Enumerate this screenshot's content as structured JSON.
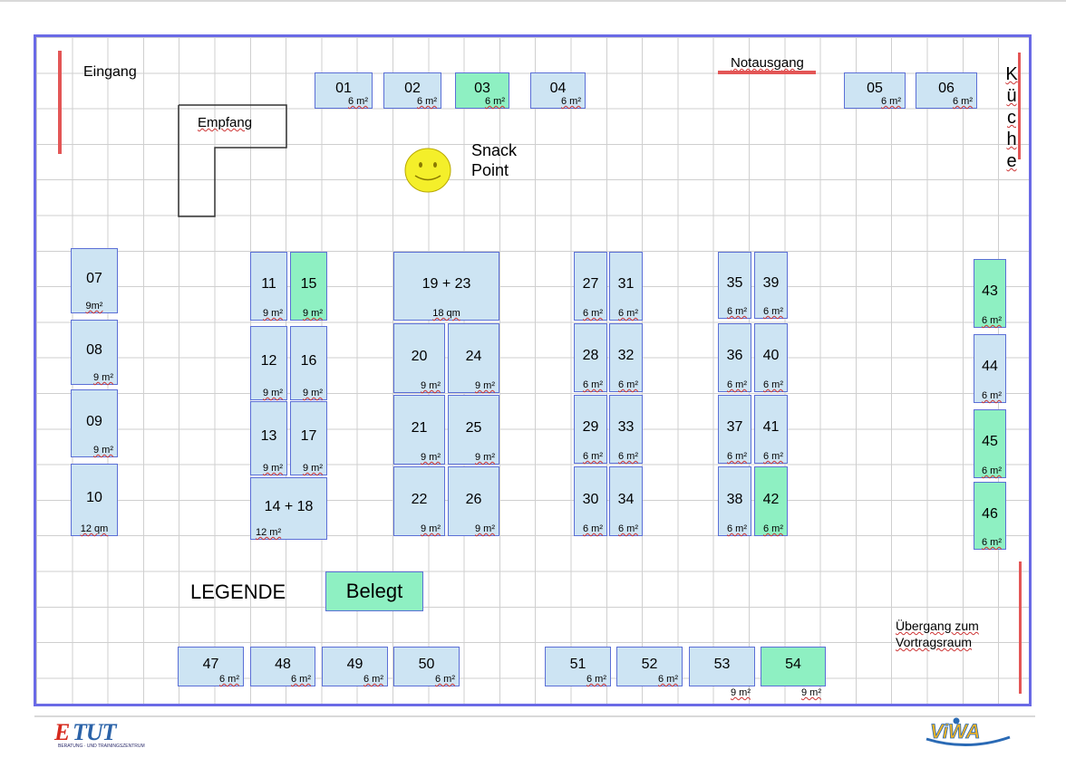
{
  "labels": {
    "entrance": "Eingang",
    "reception": "Empfang",
    "emergency_exit": "Notausgang",
    "snack_point_line1": "Snack",
    "snack_point_line2": "Point",
    "kitchen_letters": [
      "K",
      "ü",
      "c",
      "h",
      "e"
    ],
    "transition_line1": "Übergang zum",
    "transition_line2": "Vortragsraum"
  },
  "legend": {
    "title": "LEGENDE",
    "occupied_label": "Belegt",
    "occupied_color": "#8ef0c2",
    "free_color": "#cde4f3"
  },
  "logos": {
    "left": "ETUT",
    "left_subtitle": "BERATUNG · UND TRAININGSZENTRUM",
    "right": "ViWA"
  },
  "stands": [
    {
      "num": "01",
      "size": "6 m²",
      "occupied": false
    },
    {
      "num": "02",
      "size": "6 m²",
      "occupied": false
    },
    {
      "num": "03",
      "size": "6 m²",
      "occupied": true
    },
    {
      "num": "04",
      "size": "6 m²",
      "occupied": false
    },
    {
      "num": "05",
      "size": "6 m²",
      "occupied": false
    },
    {
      "num": "06",
      "size": "6 m²",
      "occupied": false
    },
    {
      "num": "07",
      "size": "9m²",
      "occupied": false
    },
    {
      "num": "08",
      "size": "9 m²",
      "occupied": false
    },
    {
      "num": "09",
      "size": "9 m²",
      "occupied": false
    },
    {
      "num": "10",
      "size": "12 qm",
      "occupied": false
    },
    {
      "num": "11",
      "size": "9 m²",
      "occupied": false
    },
    {
      "num": "15",
      "size": "9 m²",
      "occupied": true
    },
    {
      "num": "12",
      "size": "9 m²",
      "occupied": false
    },
    {
      "num": "16",
      "size": "9 m²",
      "occupied": false
    },
    {
      "num": "13",
      "size": "9 m²",
      "occupied": false
    },
    {
      "num": "17",
      "size": "9 m²",
      "occupied": false
    },
    {
      "num": "14 + 18",
      "size": "12 m²",
      "occupied": false
    },
    {
      "num": "19  +  23",
      "size": "18 qm",
      "occupied": false
    },
    {
      "num": "20",
      "size": "9 m²",
      "occupied": false
    },
    {
      "num": "24",
      "size": "9 m²",
      "occupied": false
    },
    {
      "num": "21",
      "size": "9 m²",
      "occupied": false
    },
    {
      "num": "25",
      "size": "9 m²",
      "occupied": false
    },
    {
      "num": "22",
      "size": "9 m²",
      "occupied": false
    },
    {
      "num": "26",
      "size": "9 m²",
      "occupied": false
    },
    {
      "num": "27",
      "size": "6 m²",
      "occupied": false
    },
    {
      "num": "31",
      "size": "6 m²",
      "occupied": false
    },
    {
      "num": "28",
      "size": "6 m²",
      "occupied": false
    },
    {
      "num": "32",
      "size": "6 m²",
      "occupied": false
    },
    {
      "num": "29",
      "size": "6 m²",
      "occupied": false
    },
    {
      "num": "33",
      "size": "6 m²",
      "occupied": false
    },
    {
      "num": "30",
      "size": "6 m²",
      "occupied": false
    },
    {
      "num": "34",
      "size": "6 m²",
      "occupied": false
    },
    {
      "num": "35",
      "size": "6 m²",
      "occupied": false
    },
    {
      "num": "39",
      "size": "6 m²",
      "occupied": false
    },
    {
      "num": "36",
      "size": "6 m²",
      "occupied": false
    },
    {
      "num": "40",
      "size": "6 m²",
      "occupied": false
    },
    {
      "num": "37",
      "size": "6 m²",
      "occupied": false
    },
    {
      "num": "41",
      "size": "6 m²",
      "occupied": false
    },
    {
      "num": "38",
      "size": "6 m²",
      "occupied": false
    },
    {
      "num": "42",
      "size": "6 m²",
      "occupied": true
    },
    {
      "num": "43",
      "size": "6 m²",
      "occupied": true
    },
    {
      "num": "44",
      "size": "6 m²",
      "occupied": false
    },
    {
      "num": "45",
      "size": "6 m²",
      "occupied": true
    },
    {
      "num": "46",
      "size": "6 m²",
      "occupied": true
    },
    {
      "num": "47",
      "size": "6 m²",
      "occupied": false
    },
    {
      "num": "48",
      "size": "6 m²",
      "occupied": false
    },
    {
      "num": "49",
      "size": "6 m²",
      "occupied": false
    },
    {
      "num": "50",
      "size": "6 m²",
      "occupied": false
    },
    {
      "num": "51",
      "size": "6 m²",
      "occupied": false
    },
    {
      "num": "52",
      "size": "6 m²",
      "occupied": false
    },
    {
      "num": "53",
      "size": "9 m²",
      "occupied": false
    },
    {
      "num": "54",
      "size": "9 m²",
      "occupied": true
    }
  ]
}
